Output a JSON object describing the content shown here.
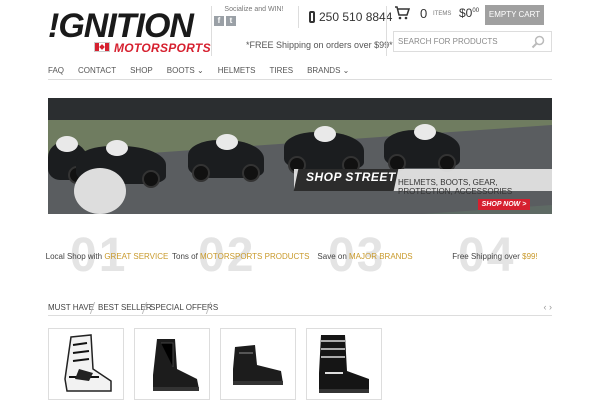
{
  "brand": {
    "main": "!GNITION",
    "sub": "MOTORSPORTS"
  },
  "social": {
    "label": "Socialize and WIN!",
    "icons": [
      "facebook-icon",
      "twitter-icon"
    ]
  },
  "header": {
    "phone": "250 510 8844",
    "shipping_note": "*FREE Shipping on orders over $99*"
  },
  "cart": {
    "count": "0",
    "items_label": "ITEMS",
    "total": "$0",
    "total_cents": "00",
    "empty_label": "EMPTY CART"
  },
  "search": {
    "placeholder": "SEARCH FOR PRODUCTS"
  },
  "nav": {
    "items": [
      {
        "label": "FAQ"
      },
      {
        "label": "CONTACT"
      },
      {
        "label": "SHOP"
      },
      {
        "label": "BOOTS ⌄"
      },
      {
        "label": "HELMETS"
      },
      {
        "label": "TIRES"
      },
      {
        "label": "BRANDS ⌄"
      }
    ]
  },
  "hero": {
    "title": "SHOP STREET",
    "subtitle": "HELMETS, BOOTS, GEAR, PROTECTION, ACCESSORIES",
    "cta": "SHOP NOW >"
  },
  "features": [
    {
      "num": "01",
      "text": "Local Shop with ",
      "highlight": "GREAT SERVICE"
    },
    {
      "num": "02",
      "text": "Tons of ",
      "highlight": "MOTORSPORTS PRODUCTS"
    },
    {
      "num": "03",
      "text": "Save on ",
      "highlight": "MAJOR BRANDS"
    },
    {
      "num": "04",
      "text": "Free Shipping over ",
      "highlight": "$99!"
    }
  ],
  "tabs": {
    "items": [
      {
        "label": "MUST HAVE"
      },
      {
        "label": "BEST SELLER"
      },
      {
        "label": "SPECIAL OFFERS"
      }
    ],
    "prev": "‹",
    "next": "›"
  },
  "colors": {
    "accent_red": "#d6202f",
    "highlight_gold": "#c99a2c",
    "button_gray": "#a0a0a0"
  }
}
